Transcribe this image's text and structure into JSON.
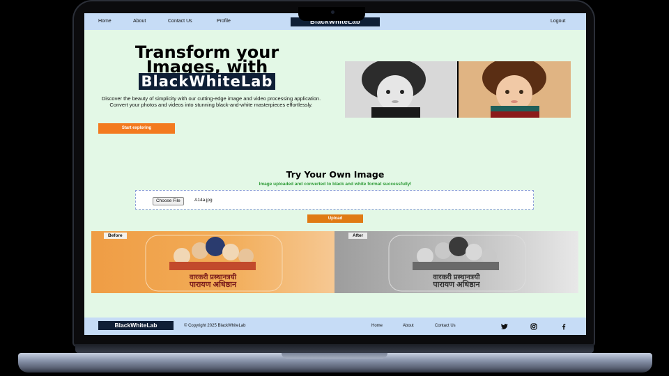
{
  "nav": {
    "home": "Home",
    "about": "About",
    "contact": "Contact Us",
    "profile": "Profile",
    "brand": "BlackWhiteLab",
    "logout": "Logout"
  },
  "hero": {
    "title": "Transform your Images, with",
    "brand": "BlackWhiteLab",
    "description": "Discover the beauty of simplicity with our cutting-edge image and video processing application. Convert your photos and videos into stunning black-and-white masterpieces effortlessly.",
    "cta": "Start exploring"
  },
  "try": {
    "title": "Try Your Own Image",
    "success_message": "Image uploaded and converted to black and white format successfully!",
    "choose_file": "Choose File",
    "file_name": "A14a.jpg",
    "upload": "Upload"
  },
  "comparison": {
    "before_label": "Before",
    "after_label": "After",
    "image_line1": "वारकरी प्रस्थानत्रयी",
    "image_line2": "पारायण अधिष्ठान"
  },
  "footer": {
    "brand": "BlackWhiteLab",
    "copyright": "© Copyright 2025 BlackWhiteLab",
    "home": "Home",
    "about": "About",
    "contact": "Contact Us",
    "social_icons": [
      "twitter-icon",
      "instagram-icon",
      "facebook-icon"
    ]
  },
  "colors": {
    "page_bg": "#e3f8e6",
    "nav_bg": "#c6dcf6",
    "brand_bg": "#0f1f36",
    "accent_orange": "#f37a1f",
    "success_green": "#2c9a35"
  }
}
